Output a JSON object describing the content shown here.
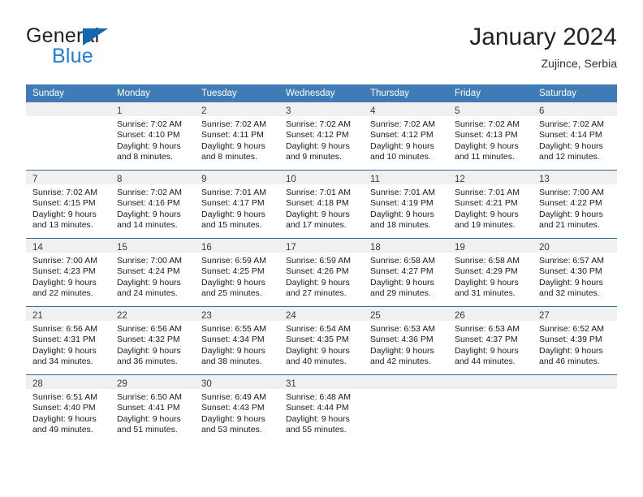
{
  "logo": {
    "word_top": "General",
    "word_bottom": "Blue",
    "triangle_color": "#1468b3",
    "blue_text_color": "#1b7fd4"
  },
  "header": {
    "title": "January 2024",
    "subtitle": "Zujince, Serbia"
  },
  "theme": {
    "header_bg": "#3f7cb5",
    "header_text": "#ffffff",
    "daynum_band_bg": "#f0f0f0",
    "week_separator": "#2e6da4"
  },
  "weekday_headers": [
    "Sunday",
    "Monday",
    "Tuesday",
    "Wednesday",
    "Thursday",
    "Friday",
    "Saturday"
  ],
  "weeks": [
    [
      {
        "day": "",
        "empty": true
      },
      {
        "day": "1",
        "sunrise": "Sunrise: 7:02 AM",
        "sunset": "Sunset: 4:10 PM",
        "daylight1": "Daylight: 9 hours",
        "daylight2": "and 8 minutes."
      },
      {
        "day": "2",
        "sunrise": "Sunrise: 7:02 AM",
        "sunset": "Sunset: 4:11 PM",
        "daylight1": "Daylight: 9 hours",
        "daylight2": "and 8 minutes."
      },
      {
        "day": "3",
        "sunrise": "Sunrise: 7:02 AM",
        "sunset": "Sunset: 4:12 PM",
        "daylight1": "Daylight: 9 hours",
        "daylight2": "and 9 minutes."
      },
      {
        "day": "4",
        "sunrise": "Sunrise: 7:02 AM",
        "sunset": "Sunset: 4:12 PM",
        "daylight1": "Daylight: 9 hours",
        "daylight2": "and 10 minutes."
      },
      {
        "day": "5",
        "sunrise": "Sunrise: 7:02 AM",
        "sunset": "Sunset: 4:13 PM",
        "daylight1": "Daylight: 9 hours",
        "daylight2": "and 11 minutes."
      },
      {
        "day": "6",
        "sunrise": "Sunrise: 7:02 AM",
        "sunset": "Sunset: 4:14 PM",
        "daylight1": "Daylight: 9 hours",
        "daylight2": "and 12 minutes."
      }
    ],
    [
      {
        "day": "7",
        "sunrise": "Sunrise: 7:02 AM",
        "sunset": "Sunset: 4:15 PM",
        "daylight1": "Daylight: 9 hours",
        "daylight2": "and 13 minutes."
      },
      {
        "day": "8",
        "sunrise": "Sunrise: 7:02 AM",
        "sunset": "Sunset: 4:16 PM",
        "daylight1": "Daylight: 9 hours",
        "daylight2": "and 14 minutes."
      },
      {
        "day": "9",
        "sunrise": "Sunrise: 7:01 AM",
        "sunset": "Sunset: 4:17 PM",
        "daylight1": "Daylight: 9 hours",
        "daylight2": "and 15 minutes."
      },
      {
        "day": "10",
        "sunrise": "Sunrise: 7:01 AM",
        "sunset": "Sunset: 4:18 PM",
        "daylight1": "Daylight: 9 hours",
        "daylight2": "and 17 minutes."
      },
      {
        "day": "11",
        "sunrise": "Sunrise: 7:01 AM",
        "sunset": "Sunset: 4:19 PM",
        "daylight1": "Daylight: 9 hours",
        "daylight2": "and 18 minutes."
      },
      {
        "day": "12",
        "sunrise": "Sunrise: 7:01 AM",
        "sunset": "Sunset: 4:21 PM",
        "daylight1": "Daylight: 9 hours",
        "daylight2": "and 19 minutes."
      },
      {
        "day": "13",
        "sunrise": "Sunrise: 7:00 AM",
        "sunset": "Sunset: 4:22 PM",
        "daylight1": "Daylight: 9 hours",
        "daylight2": "and 21 minutes."
      }
    ],
    [
      {
        "day": "14",
        "sunrise": "Sunrise: 7:00 AM",
        "sunset": "Sunset: 4:23 PM",
        "daylight1": "Daylight: 9 hours",
        "daylight2": "and 22 minutes."
      },
      {
        "day": "15",
        "sunrise": "Sunrise: 7:00 AM",
        "sunset": "Sunset: 4:24 PM",
        "daylight1": "Daylight: 9 hours",
        "daylight2": "and 24 minutes."
      },
      {
        "day": "16",
        "sunrise": "Sunrise: 6:59 AM",
        "sunset": "Sunset: 4:25 PM",
        "daylight1": "Daylight: 9 hours",
        "daylight2": "and 25 minutes."
      },
      {
        "day": "17",
        "sunrise": "Sunrise: 6:59 AM",
        "sunset": "Sunset: 4:26 PM",
        "daylight1": "Daylight: 9 hours",
        "daylight2": "and 27 minutes."
      },
      {
        "day": "18",
        "sunrise": "Sunrise: 6:58 AM",
        "sunset": "Sunset: 4:27 PM",
        "daylight1": "Daylight: 9 hours",
        "daylight2": "and 29 minutes."
      },
      {
        "day": "19",
        "sunrise": "Sunrise: 6:58 AM",
        "sunset": "Sunset: 4:29 PM",
        "daylight1": "Daylight: 9 hours",
        "daylight2": "and 31 minutes."
      },
      {
        "day": "20",
        "sunrise": "Sunrise: 6:57 AM",
        "sunset": "Sunset: 4:30 PM",
        "daylight1": "Daylight: 9 hours",
        "daylight2": "and 32 minutes."
      }
    ],
    [
      {
        "day": "21",
        "sunrise": "Sunrise: 6:56 AM",
        "sunset": "Sunset: 4:31 PM",
        "daylight1": "Daylight: 9 hours",
        "daylight2": "and 34 minutes."
      },
      {
        "day": "22",
        "sunrise": "Sunrise: 6:56 AM",
        "sunset": "Sunset: 4:32 PM",
        "daylight1": "Daylight: 9 hours",
        "daylight2": "and 36 minutes."
      },
      {
        "day": "23",
        "sunrise": "Sunrise: 6:55 AM",
        "sunset": "Sunset: 4:34 PM",
        "daylight1": "Daylight: 9 hours",
        "daylight2": "and 38 minutes."
      },
      {
        "day": "24",
        "sunrise": "Sunrise: 6:54 AM",
        "sunset": "Sunset: 4:35 PM",
        "daylight1": "Daylight: 9 hours",
        "daylight2": "and 40 minutes."
      },
      {
        "day": "25",
        "sunrise": "Sunrise: 6:53 AM",
        "sunset": "Sunset: 4:36 PM",
        "daylight1": "Daylight: 9 hours",
        "daylight2": "and 42 minutes."
      },
      {
        "day": "26",
        "sunrise": "Sunrise: 6:53 AM",
        "sunset": "Sunset: 4:37 PM",
        "daylight1": "Daylight: 9 hours",
        "daylight2": "and 44 minutes."
      },
      {
        "day": "27",
        "sunrise": "Sunrise: 6:52 AM",
        "sunset": "Sunset: 4:39 PM",
        "daylight1": "Daylight: 9 hours",
        "daylight2": "and 46 minutes."
      }
    ],
    [
      {
        "day": "28",
        "sunrise": "Sunrise: 6:51 AM",
        "sunset": "Sunset: 4:40 PM",
        "daylight1": "Daylight: 9 hours",
        "daylight2": "and 49 minutes."
      },
      {
        "day": "29",
        "sunrise": "Sunrise: 6:50 AM",
        "sunset": "Sunset: 4:41 PM",
        "daylight1": "Daylight: 9 hours",
        "daylight2": "and 51 minutes."
      },
      {
        "day": "30",
        "sunrise": "Sunrise: 6:49 AM",
        "sunset": "Sunset: 4:43 PM",
        "daylight1": "Daylight: 9 hours",
        "daylight2": "and 53 minutes."
      },
      {
        "day": "31",
        "sunrise": "Sunrise: 6:48 AM",
        "sunset": "Sunset: 4:44 PM",
        "daylight1": "Daylight: 9 hours",
        "daylight2": "and 55 minutes."
      },
      {
        "day": "",
        "empty": true
      },
      {
        "day": "",
        "empty": true
      },
      {
        "day": "",
        "empty": true
      }
    ]
  ]
}
